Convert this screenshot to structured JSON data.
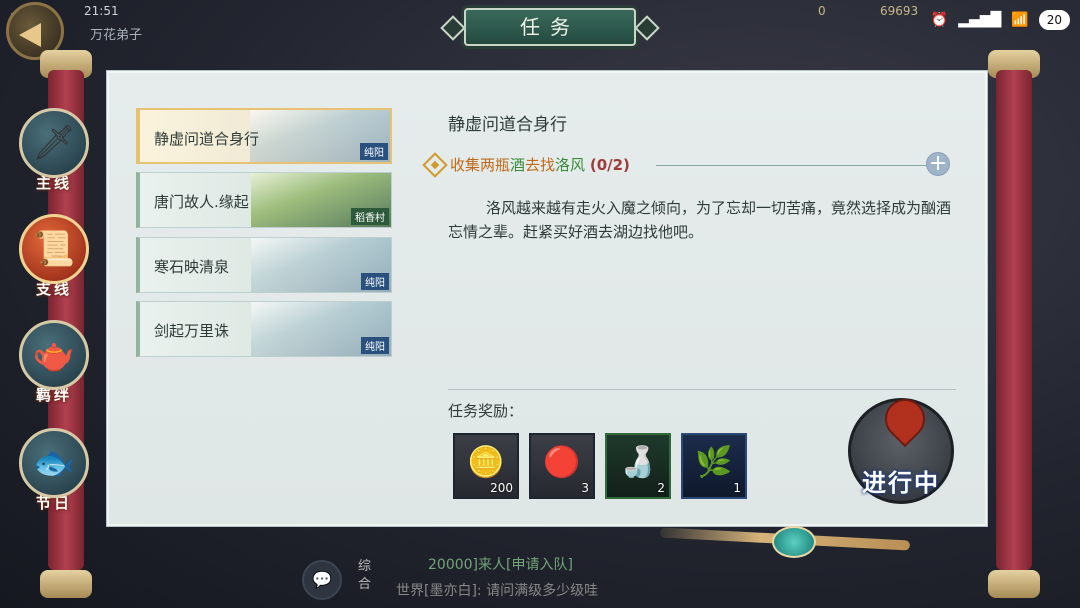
{
  "status_bar": {
    "time": "21:51",
    "battery": "20"
  },
  "background_hud": {
    "time": "21:51",
    "player_name": "万花弟子",
    "resource_1": "0",
    "resource_2": "69693"
  },
  "window": {
    "title": "任务"
  },
  "categories": [
    {
      "label": "主线",
      "icon": "sword-icon"
    },
    {
      "label": "支线",
      "icon": "scroll-icon"
    },
    {
      "label": "羁绊",
      "icon": "teapot-icon"
    },
    {
      "label": "节日",
      "icon": "fish-icon"
    }
  ],
  "active_category": "支线",
  "tasks": [
    {
      "name": "静虚问道合身行",
      "tag": "纯阳",
      "selected": true
    },
    {
      "name": "唐门故人.缘起",
      "tag": "稻香村",
      "selected": false
    },
    {
      "name": "寒石映清泉",
      "tag": "纯阳",
      "selected": false
    },
    {
      "name": "剑起万里诛",
      "tag": "纯阳",
      "selected": false
    }
  ],
  "detail": {
    "title": "静虚问道合身行",
    "objective": {
      "part1": "收集两瓶",
      "part2": "酒",
      "part3": "去找",
      "part4": "洛风",
      "count": "(0/2)"
    },
    "description": "洛风越来越有走火入魔之倾向，为了忘却一切苦痛，竟然选择成为酗酒忘情之辈。赶紧买好酒去湖边找他吧。",
    "rewards_label": "任务奖励：",
    "rewards": [
      {
        "icon": "gold-ingot-icon",
        "count": "200"
      },
      {
        "icon": "red-ball-icon",
        "count": "3"
      },
      {
        "icon": "wine-jar-icon",
        "count": "2"
      },
      {
        "icon": "tea-leaf-icon",
        "count": "1"
      }
    ],
    "status_button": "进行中"
  },
  "chat": {
    "tab": "综合",
    "line1": "20000]来人[申请入队]",
    "line2": "世界[墨亦白]: 请问满级多少级哇"
  },
  "colors": {
    "objective_orange": "#c06a17",
    "objective_green": "#3a8a3a",
    "count_red": "#a03a3a",
    "title_plate": "#2f5a4e",
    "selected_border": "#e9c173"
  }
}
